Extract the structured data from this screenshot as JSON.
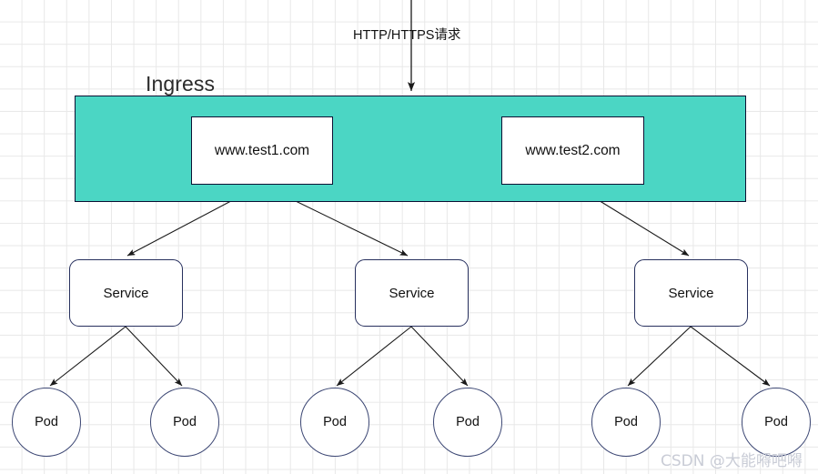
{
  "diagram": {
    "title": "Ingress",
    "entry_arrow_label": "HTTP/HTTPS请求",
    "colors": {
      "ingress_fill": "#4BD6C4",
      "ingress_stroke": "#0b1033",
      "box_stroke": "#0d1133",
      "service_stroke": "#27305e",
      "pod_stroke": "#3b4673",
      "edge_stroke": "#1a1a1a",
      "grid": "#e8e8e8",
      "watermark": "#c9ccd6"
    },
    "hosts": [
      {
        "label": "www.test1.com"
      },
      {
        "label": "www.test2.com"
      }
    ],
    "services": [
      {
        "label": "Service"
      },
      {
        "label": "Service"
      },
      {
        "label": "Service"
      }
    ],
    "pods": [
      {
        "label": "Pod"
      },
      {
        "label": "Pod"
      },
      {
        "label": "Pod"
      },
      {
        "label": "Pod"
      },
      {
        "label": "Pod"
      },
      {
        "label": "Pod"
      }
    ]
  },
  "watermark": {
    "text": "CSDN @大能嘚吧嘚"
  }
}
